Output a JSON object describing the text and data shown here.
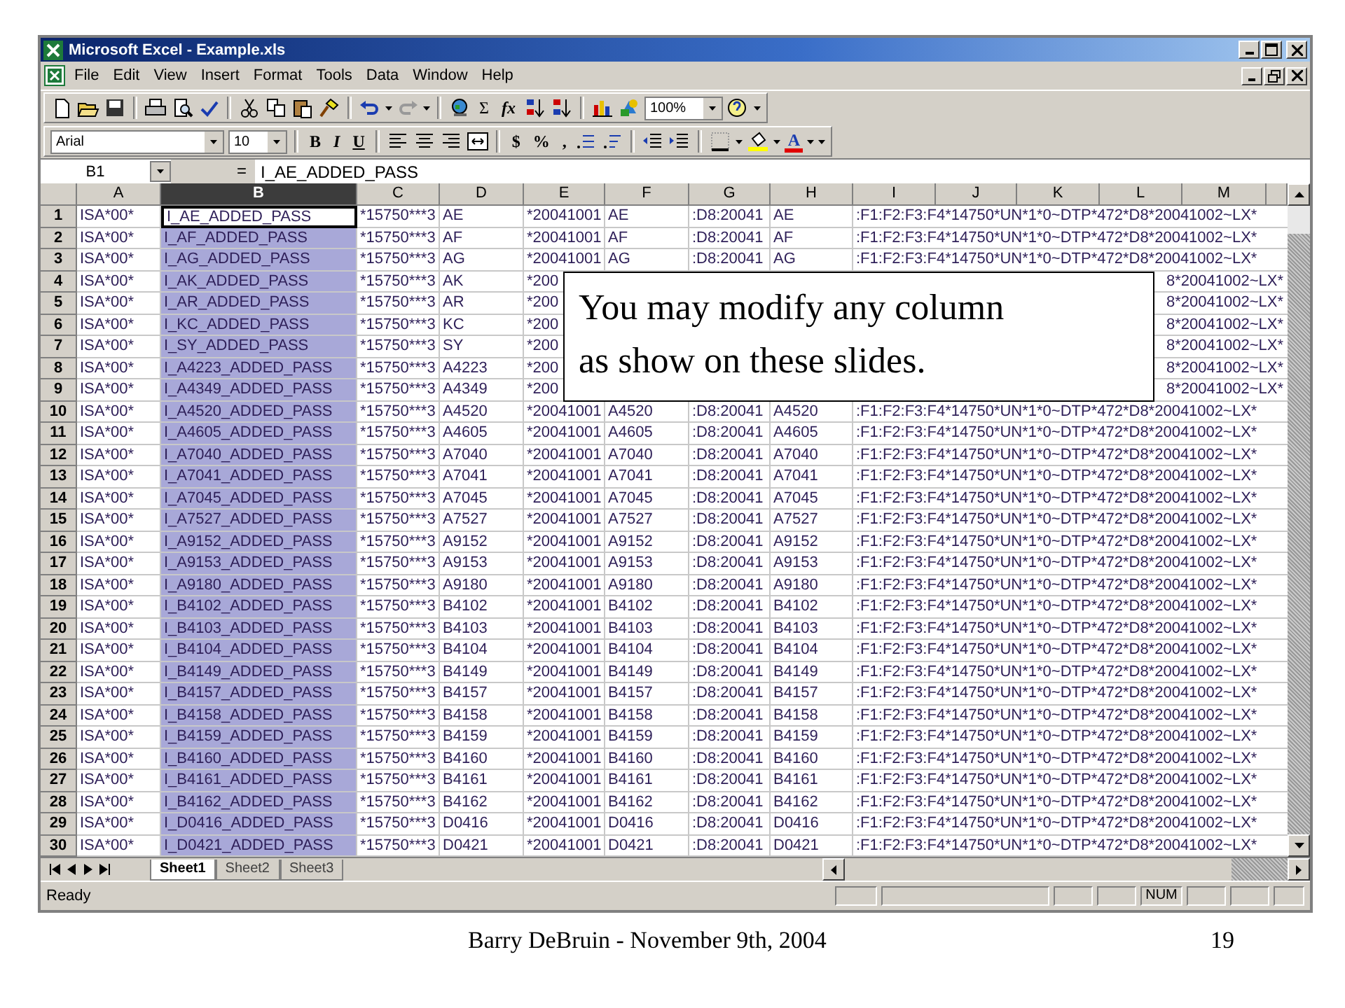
{
  "window": {
    "title": "Microsoft Excel - Example.xls"
  },
  "menu": [
    "File",
    "Edit",
    "View",
    "Insert",
    "Format",
    "Tools",
    "Data",
    "Window",
    "Help"
  ],
  "toolbar": {
    "sum": "Σ",
    "function": "fx",
    "zoom": "100%"
  },
  "formatting": {
    "font": "Arial",
    "size": "10",
    "bold": "B",
    "italic": "I",
    "underline": "U",
    "currency": "$",
    "percent": "%",
    "comma": ",",
    "font_color": "A"
  },
  "formula_bar": {
    "name_box": "B1",
    "equals": "=",
    "value": "I_AE_ADDED_PASS"
  },
  "sheet": {
    "columns": [
      {
        "label": "A",
        "selected": false
      },
      {
        "label": "B",
        "selected": true
      },
      {
        "label": "C",
        "selected": false
      },
      {
        "label": "D",
        "selected": false
      },
      {
        "label": "E",
        "selected": false
      },
      {
        "label": "F",
        "selected": false
      },
      {
        "label": "G",
        "selected": false
      },
      {
        "label": "H",
        "selected": false
      },
      {
        "label": "I",
        "selected": false
      },
      {
        "label": "J",
        "selected": false
      },
      {
        "label": "K",
        "selected": false
      },
      {
        "label": "L",
        "selected": false
      },
      {
        "label": "M",
        "selected": false
      }
    ],
    "rows": [
      {
        "row": "1",
        "active": true,
        "a": "ISA*00*",
        "b": "I_AE_ADDED_PASS",
        "c": "*15750***3",
        "d": "AE",
        "e": "*20041001",
        "f": "AE",
        "g": ":D8:20041",
        "h": "AE",
        "i": ":F1:F2:F3:F4*14750*UN*1*0~DTP*472*D8*20041002~LX*"
      },
      {
        "row": "2",
        "active": false,
        "a": "ISA*00*",
        "b": "I_AF_ADDED_PASS",
        "c": "*15750***3",
        "d": "AF",
        "e": "*20041001",
        "f": "AF",
        "g": ":D8:20041",
        "h": "AF",
        "i": ":F1:F2:F3:F4*14750*UN*1*0~DTP*472*D8*20041002~LX*"
      },
      {
        "row": "3",
        "active": false,
        "a": "ISA*00*",
        "b": "I_AG_ADDED_PASS",
        "c": "*15750***3",
        "d": "AG",
        "e": "*20041001",
        "f": "AG",
        "g": ":D8:20041",
        "h": "AG",
        "i": ":F1:F2:F3:F4*14750*UN*1*0~DTP*472*D8*20041002~LX*"
      },
      {
        "row": "4",
        "active": false,
        "a": "ISA*00*",
        "b": "I_AK_ADDED_PASS",
        "c": "*15750***3",
        "d": "AK",
        "e": "*200",
        "tail": "8*20041002~LX*"
      },
      {
        "row": "5",
        "active": false,
        "a": "ISA*00*",
        "b": "I_AR_ADDED_PASS",
        "c": "*15750***3",
        "d": "AR",
        "e": "*200",
        "tail": "8*20041002~LX*"
      },
      {
        "row": "6",
        "active": false,
        "a": "ISA*00*",
        "b": "I_KC_ADDED_PASS",
        "c": "*15750***3",
        "d": "KC",
        "e": "*200",
        "tail": "8*20041002~LX*"
      },
      {
        "row": "7",
        "active": false,
        "a": "ISA*00*",
        "b": "I_SY_ADDED_PASS",
        "c": "*15750***3",
        "d": "SY",
        "e": "*200",
        "tail": "8*20041002~LX*"
      },
      {
        "row": "8",
        "active": false,
        "a": "ISA*00*",
        "b": "I_A4223_ADDED_PASS",
        "c": "*15750***3",
        "d": "A4223",
        "e": "*200",
        "tail": "8*20041002~LX*"
      },
      {
        "row": "9",
        "active": false,
        "a": "ISA*00*",
        "b": "I_A4349_ADDED_PASS",
        "c": "*15750***3",
        "d": "A4349",
        "e": "*200",
        "tail": "8*20041002~LX*"
      },
      {
        "row": "10",
        "active": false,
        "a": "ISA*00*",
        "b": "I_A4520_ADDED_PASS",
        "c": "*15750***3",
        "d": "A4520",
        "e": "*20041001",
        "f": "A4520",
        "g": ":D8:20041",
        "h": "A4520",
        "i": ":F1:F2:F3:F4*14750*UN*1*0~DTP*472*D8*20041002~LX*"
      },
      {
        "row": "11",
        "active": false,
        "a": "ISA*00*",
        "b": "I_A4605_ADDED_PASS",
        "c": "*15750***3",
        "d": "A4605",
        "e": "*20041001",
        "f": "A4605",
        "g": ":D8:20041",
        "h": "A4605",
        "i": ":F1:F2:F3:F4*14750*UN*1*0~DTP*472*D8*20041002~LX*"
      },
      {
        "row": "12",
        "active": false,
        "a": "ISA*00*",
        "b": "I_A7040_ADDED_PASS",
        "c": "*15750***3",
        "d": "A7040",
        "e": "*20041001",
        "f": "A7040",
        "g": ":D8:20041",
        "h": "A7040",
        "i": ":F1:F2:F3:F4*14750*UN*1*0~DTP*472*D8*20041002~LX*"
      },
      {
        "row": "13",
        "active": false,
        "a": "ISA*00*",
        "b": "I_A7041_ADDED_PASS",
        "c": "*15750***3",
        "d": "A7041",
        "e": "*20041001",
        "f": "A7041",
        "g": ":D8:20041",
        "h": "A7041",
        "i": ":F1:F2:F3:F4*14750*UN*1*0~DTP*472*D8*20041002~LX*"
      },
      {
        "row": "14",
        "active": false,
        "a": "ISA*00*",
        "b": "I_A7045_ADDED_PASS",
        "c": "*15750***3",
        "d": "A7045",
        "e": "*20041001",
        "f": "A7045",
        "g": ":D8:20041",
        "h": "A7045",
        "i": ":F1:F2:F3:F4*14750*UN*1*0~DTP*472*D8*20041002~LX*"
      },
      {
        "row": "15",
        "active": false,
        "a": "ISA*00*",
        "b": "I_A7527_ADDED_PASS",
        "c": "*15750***3",
        "d": "A7527",
        "e": "*20041001",
        "f": "A7527",
        "g": ":D8:20041",
        "h": "A7527",
        "i": ":F1:F2:F3:F4*14750*UN*1*0~DTP*472*D8*20041002~LX*"
      },
      {
        "row": "16",
        "active": false,
        "a": "ISA*00*",
        "b": "I_A9152_ADDED_PASS",
        "c": "*15750***3",
        "d": "A9152",
        "e": "*20041001",
        "f": "A9152",
        "g": ":D8:20041",
        "h": "A9152",
        "i": ":F1:F2:F3:F4*14750*UN*1*0~DTP*472*D8*20041002~LX*"
      },
      {
        "row": "17",
        "active": false,
        "a": "ISA*00*",
        "b": "I_A9153_ADDED_PASS",
        "c": "*15750***3",
        "d": "A9153",
        "e": "*20041001",
        "f": "A9153",
        "g": ":D8:20041",
        "h": "A9153",
        "i": ":F1:F2:F3:F4*14750*UN*1*0~DTP*472*D8*20041002~LX*"
      },
      {
        "row": "18",
        "active": false,
        "a": "ISA*00*",
        "b": "I_A9180_ADDED_PASS",
        "c": "*15750***3",
        "d": "A9180",
        "e": "*20041001",
        "f": "A9180",
        "g": ":D8:20041",
        "h": "A9180",
        "i": ":F1:F2:F3:F4*14750*UN*1*0~DTP*472*D8*20041002~LX*"
      },
      {
        "row": "19",
        "active": false,
        "a": "ISA*00*",
        "b": "I_B4102_ADDED_PASS",
        "c": "*15750***3",
        "d": "B4102",
        "e": "*20041001",
        "f": "B4102",
        "g": ":D8:20041",
        "h": "B4102",
        "i": ":F1:F2:F3:F4*14750*UN*1*0~DTP*472*D8*20041002~LX*"
      },
      {
        "row": "20",
        "active": false,
        "a": "ISA*00*",
        "b": "I_B4103_ADDED_PASS",
        "c": "*15750***3",
        "d": "B4103",
        "e": "*20041001",
        "f": "B4103",
        "g": ":D8:20041",
        "h": "B4103",
        "i": ":F1:F2:F3:F4*14750*UN*1*0~DTP*472*D8*20041002~LX*"
      },
      {
        "row": "21",
        "active": false,
        "a": "ISA*00*",
        "b": "I_B4104_ADDED_PASS",
        "c": "*15750***3",
        "d": "B4104",
        "e": "*20041001",
        "f": "B4104",
        "g": ":D8:20041",
        "h": "B4104",
        "i": ":F1:F2:F3:F4*14750*UN*1*0~DTP*472*D8*20041002~LX*"
      },
      {
        "row": "22",
        "active": false,
        "a": "ISA*00*",
        "b": "I_B4149_ADDED_PASS",
        "c": "*15750***3",
        "d": "B4149",
        "e": "*20041001",
        "f": "B4149",
        "g": ":D8:20041",
        "h": "B4149",
        "i": ":F1:F2:F3:F4*14750*UN*1*0~DTP*472*D8*20041002~LX*"
      },
      {
        "row": "23",
        "active": false,
        "a": "ISA*00*",
        "b": "I_B4157_ADDED_PASS",
        "c": "*15750***3",
        "d": "B4157",
        "e": "*20041001",
        "f": "B4157",
        "g": ":D8:20041",
        "h": "B4157",
        "i": ":F1:F2:F3:F4*14750*UN*1*0~DTP*472*D8*20041002~LX*"
      },
      {
        "row": "24",
        "active": false,
        "a": "ISA*00*",
        "b": "I_B4158_ADDED_PASS",
        "c": "*15750***3",
        "d": "B4158",
        "e": "*20041001",
        "f": "B4158",
        "g": ":D8:20041",
        "h": "B4158",
        "i": ":F1:F2:F3:F4*14750*UN*1*0~DTP*472*D8*20041002~LX*"
      },
      {
        "row": "25",
        "active": false,
        "a": "ISA*00*",
        "b": "I_B4159_ADDED_PASS",
        "c": "*15750***3",
        "d": "B4159",
        "e": "*20041001",
        "f": "B4159",
        "g": ":D8:20041",
        "h": "B4159",
        "i": ":F1:F2:F3:F4*14750*UN*1*0~DTP*472*D8*20041002~LX*"
      },
      {
        "row": "26",
        "active": false,
        "a": "ISA*00*",
        "b": "I_B4160_ADDED_PASS",
        "c": "*15750***3",
        "d": "B4160",
        "e": "*20041001",
        "f": "B4160",
        "g": ":D8:20041",
        "h": "B4160",
        "i": ":F1:F2:F3:F4*14750*UN*1*0~DTP*472*D8*20041002~LX*"
      },
      {
        "row": "27",
        "active": false,
        "a": "ISA*00*",
        "b": "I_B4161_ADDED_PASS",
        "c": "*15750***3",
        "d": "B4161",
        "e": "*20041001",
        "f": "B4161",
        "g": ":D8:20041",
        "h": "B4161",
        "i": ":F1:F2:F3:F4*14750*UN*1*0~DTP*472*D8*20041002~LX*"
      },
      {
        "row": "28",
        "active": false,
        "a": "ISA*00*",
        "b": "I_B4162_ADDED_PASS",
        "c": "*15750***3",
        "d": "B4162",
        "e": "*20041001",
        "f": "B4162",
        "g": ":D8:20041",
        "h": "B4162",
        "i": ":F1:F2:F3:F4*14750*UN*1*0~DTP*472*D8*20041002~LX*"
      },
      {
        "row": "29",
        "active": false,
        "a": "ISA*00*",
        "b": "I_D0416_ADDED_PASS",
        "c": "*15750***3",
        "d": "D0416",
        "e": "*20041001",
        "f": "D0416",
        "g": ":D8:20041",
        "h": "D0416",
        "i": ":F1:F2:F3:F4*14750*UN*1*0~DTP*472*D8*20041002~LX*"
      },
      {
        "row": "30",
        "active": false,
        "a": "ISA*00*",
        "b": "I_D0421_ADDED_PASS",
        "c": "*15750***3",
        "d": "D0421",
        "e": "*20041001",
        "f": "D0421",
        "g": ":D8:20041",
        "h": "D0421",
        "i": ":F1:F2:F3:F4*14750*UN*1*0~DTP*472*D8*20041002~LX*"
      }
    ]
  },
  "callout": [
    "You may modify any column",
    "as show on these slides."
  ],
  "sheet_tabs": [
    {
      "label": "Sheet1",
      "selected": true
    },
    {
      "label": "Sheet2",
      "selected": false
    },
    {
      "label": "Sheet3",
      "selected": false
    }
  ],
  "status_bar": {
    "status": "Ready",
    "indicator": "NUM"
  },
  "footer": {
    "text": "Barry DeBruin - November 9th, 2004",
    "page": "19"
  }
}
